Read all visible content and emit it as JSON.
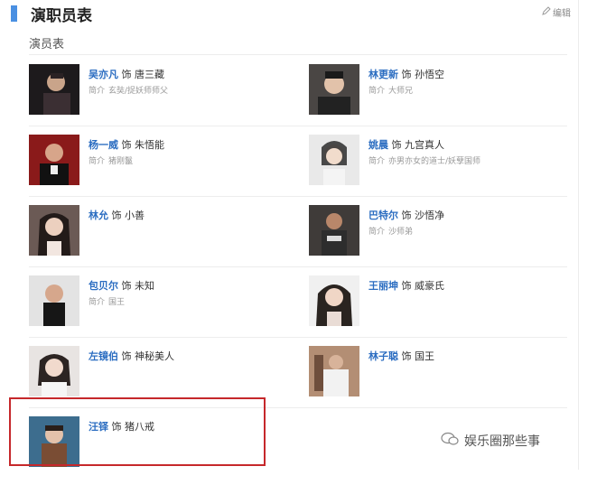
{
  "header": {
    "title": "演职员表",
    "edit_label": "编辑"
  },
  "subtitle": "演员表",
  "colors": {
    "accent": "#4a90e2",
    "link": "#2b6dc1",
    "highlight_border": "#c6282b"
  },
  "cast": [
    {
      "actor": "吴亦凡",
      "as": "饰",
      "role": "唐三藏",
      "intro_label": "简介",
      "intro": "玄奘/捉妖师师父"
    },
    {
      "actor": "林更新",
      "as": "饰",
      "role": "孙悟空",
      "intro_label": "简介",
      "intro": "大师兄"
    },
    {
      "actor": "杨一威",
      "as": "饰",
      "role": "朱悟能",
      "intro_label": "简介",
      "intro": "猪刚鬣"
    },
    {
      "actor": "姚晨",
      "as": "饰",
      "role": "九宫真人",
      "intro_label": "简介",
      "intro": "亦男亦女的道士/妖孽国师"
    },
    {
      "actor": "林允",
      "as": "饰",
      "role": "小善",
      "intro_label": "",
      "intro": ""
    },
    {
      "actor": "巴特尔",
      "as": "饰",
      "role": "沙悟净",
      "intro_label": "简介",
      "intro": "沙师弟"
    },
    {
      "actor": "包贝尔",
      "as": "饰",
      "role": "未知",
      "intro_label": "简介",
      "intro": "国王"
    },
    {
      "actor": "王丽坤",
      "as": "饰",
      "role": "威豪氏",
      "intro_label": "",
      "intro": ""
    },
    {
      "actor": "左镜伯",
      "as": "饰",
      "role": "神秘美人",
      "intro_label": "",
      "intro": ""
    },
    {
      "actor": "林子聪",
      "as": "饰",
      "role": "国王",
      "intro_label": "",
      "intro": ""
    },
    {
      "actor": "汪铎",
      "as": "饰",
      "role": "猪八戒",
      "intro_label": "",
      "intro": ""
    }
  ],
  "watermark": "娱乐圈那些事"
}
